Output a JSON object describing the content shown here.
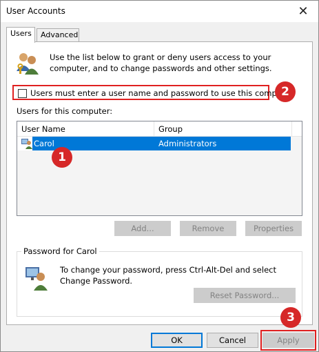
{
  "window": {
    "title": "User Accounts",
    "close_glyph": "✕"
  },
  "tabs": [
    {
      "label": "Users",
      "active": true
    },
    {
      "label": "Advanced",
      "active": false
    }
  ],
  "intro_text": "Use the list below to grant or deny users access to your computer, and to change passwords and other settings.",
  "require_login": {
    "label": "Users must enter a user name and password to use this computer.",
    "checked": false
  },
  "users_section": {
    "label": "Users for this computer:",
    "columns": [
      "User Name",
      "Group"
    ],
    "rows": [
      {
        "name": "Carol",
        "group": "Administrators",
        "selected": true
      }
    ]
  },
  "user_buttons": {
    "add": "Add...",
    "remove": "Remove",
    "properties": "Properties"
  },
  "password_group": {
    "legend": "Password for Carol",
    "text": "To change your password, press Ctrl-Alt-Del and select Change Password.",
    "reset_button": "Reset Password..."
  },
  "dialog_buttons": {
    "ok": "OK",
    "cancel": "Cancel",
    "apply": "Apply"
  },
  "markers": [
    "1",
    "2",
    "3"
  ],
  "colors": {
    "selection": "#0078d7",
    "highlight": "#e02020",
    "marker": "#d62828"
  }
}
